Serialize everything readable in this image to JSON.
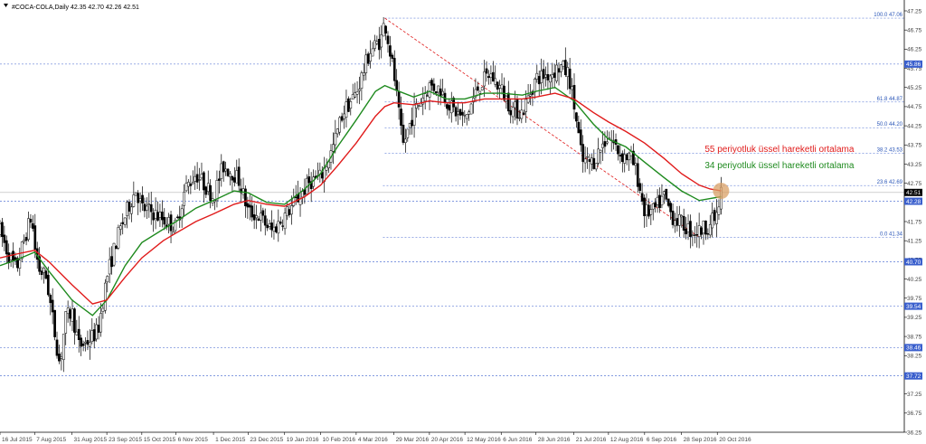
{
  "chart_data": {
    "type": "line",
    "title": "#COCA-COLA,Daily  42.35 42.70 42.26 42.51",
    "current_price": 42.51,
    "ylim": [
      36.25,
      47.25
    ],
    "y_ticks": [
      36.25,
      36.75,
      37.25,
      37.75,
      38.25,
      38.75,
      39.25,
      39.75,
      40.25,
      40.75,
      41.25,
      41.75,
      42.25,
      42.75,
      43.25,
      43.75,
      44.25,
      44.75,
      45.25,
      45.75,
      46.25,
      46.75,
      47.25
    ],
    "y_tick_labels": [
      "36.25",
      "36.75",
      "37.25",
      "37.75",
      "38.25",
      "38.75",
      "39.25",
      "39.75",
      "40.25",
      "40.75",
      "41.25",
      "41.75",
      "42.25",
      "42.75",
      "43.25",
      "43.75",
      "44.25",
      "44.75",
      "45.25",
      "45.75",
      "46.25",
      "46.75",
      "47.25"
    ],
    "x_tick_labels": [
      "16 Jul 2015",
      "7 Aug 2015",
      "31 Aug 2015",
      "23 Sep 2015",
      "15 Oct 2015",
      "6 Nov 2015",
      "1 Dec 2015",
      "23 Dec 2015",
      "19 Jan 2016",
      "10 Feb 2016",
      "4 Mar 2016",
      "29 Mar 2016",
      "20 Apr 2016",
      "12 May 2016",
      "6 Jun 2016",
      "28 Jun 2016",
      "21 Jul 2016",
      "12 Aug 2016",
      "6 Sep 2016",
      "28 Sep 2016",
      "20 Oct 2016"
    ],
    "x_tick_pos": [
      0.0,
      0.0636,
      0.1322,
      0.1963,
      0.2606,
      0.3235,
      0.3923,
      0.456,
      0.523,
      0.5891,
      0.6545,
      0.7238,
      0.7891,
      0.8543,
      0.921,
      0.9849,
      1.0547,
      1.1181,
      1.1845,
      1.2523,
      1.3181
    ],
    "price_levels": [
      45.86,
      42.28,
      40.7,
      39.54,
      38.46,
      37.72
    ],
    "price_level_labels": [
      "45.86",
      "42.28",
      "40.70",
      "39.54",
      "38.46",
      "37.72"
    ],
    "fibonacci": {
      "levels": [
        {
          "label": "100.0 47.06",
          "value": 47.06
        },
        {
          "label": "61.8 44.87",
          "value": 44.87
        },
        {
          "label": "50.0 44.20",
          "value": 44.2
        },
        {
          "label": "38.2 43.53",
          "value": 43.53
        },
        {
          "label": "23.6 42.69",
          "value": 42.69
        },
        {
          "label": "0.0 41.34",
          "value": 41.34
        }
      ],
      "trend_from": {
        "x": 0.707,
        "y": 47.06
      },
      "trend_to": {
        "x": 1.285,
        "y": 41.34
      }
    },
    "ohlc_points": [
      [
        0.0,
        41.5
      ],
      [
        0.015,
        40.9
      ],
      [
        0.03,
        40.5
      ],
      [
        0.045,
        41.3
      ],
      [
        0.058,
        41.9
      ],
      [
        0.0636,
        41.1
      ],
      [
        0.072,
        40.5
      ],
      [
        0.085,
        40.3
      ],
      [
        0.1,
        38.9
      ],
      [
        0.11,
        38.0
      ],
      [
        0.12,
        39.2
      ],
      [
        0.1322,
        39.4
      ],
      [
        0.145,
        38.5
      ],
      [
        0.16,
        38.6
      ],
      [
        0.18,
        38.9
      ],
      [
        0.1963,
        40.3
      ],
      [
        0.215,
        41.3
      ],
      [
        0.235,
        42.1
      ],
      [
        0.25,
        42.6
      ],
      [
        0.2606,
        42.1
      ],
      [
        0.28,
        42.0
      ],
      [
        0.3,
        41.8
      ],
      [
        0.3235,
        41.6
      ],
      [
        0.34,
        42.6
      ],
      [
        0.36,
        43.0
      ],
      [
        0.3923,
        42.4
      ],
      [
        0.41,
        43.2
      ],
      [
        0.43,
        43.0
      ],
      [
        0.44,
        42.8
      ],
      [
        0.456,
        42.0
      ],
      [
        0.475,
        41.9
      ],
      [
        0.5,
        41.5
      ],
      [
        0.523,
        41.9
      ],
      [
        0.545,
        42.3
      ],
      [
        0.57,
        42.8
      ],
      [
        0.5891,
        42.9
      ],
      [
        0.61,
        43.6
      ],
      [
        0.63,
        44.6
      ],
      [
        0.6545,
        45.1
      ],
      [
        0.68,
        46.2
      ],
      [
        0.7,
        46.5
      ],
      [
        0.707,
        47.0
      ],
      [
        0.7238,
        45.6
      ],
      [
        0.74,
        43.7
      ],
      [
        0.76,
        44.6
      ],
      [
        0.7891,
        45.3
      ],
      [
        0.81,
        45.2
      ],
      [
        0.83,
        44.7
      ],
      [
        0.8543,
        44.4
      ],
      [
        0.88,
        45.3
      ],
      [
        0.9,
        45.6
      ],
      [
        0.921,
        45.2
      ],
      [
        0.94,
        44.7
      ],
      [
        0.96,
        44.6
      ],
      [
        0.9849,
        45.5
      ],
      [
        1.01,
        45.6
      ],
      [
        1.03,
        45.8
      ],
      [
        1.045,
        45.6
      ],
      [
        1.0547,
        44.8
      ],
      [
        1.07,
        43.3
      ],
      [
        1.09,
        43.3
      ],
      [
        1.105,
        43.7
      ],
      [
        1.1181,
        44.0
      ],
      [
        1.14,
        43.5
      ],
      [
        1.16,
        43.4
      ],
      [
        1.17,
        43.0
      ],
      [
        1.1845,
        42.0
      ],
      [
        1.2,
        42.0
      ],
      [
        1.22,
        42.4
      ],
      [
        1.235,
        41.9
      ],
      [
        1.2523,
        41.7
      ],
      [
        1.27,
        41.5
      ],
      [
        1.285,
        41.5
      ],
      [
        1.305,
        41.7
      ],
      [
        1.3181,
        41.9
      ],
      [
        1.325,
        42.51
      ]
    ],
    "series": [
      {
        "name": "34 periyotluk üssel hareketli ortalama",
        "color": "#1e8a1e",
        "values": [
          [
            0.0,
            40.6
          ],
          [
            0.03,
            40.75
          ],
          [
            0.0636,
            40.95
          ],
          [
            0.09,
            40.45
          ],
          [
            0.1322,
            39.7
          ],
          [
            0.17,
            39.3
          ],
          [
            0.1963,
            39.7
          ],
          [
            0.23,
            40.6
          ],
          [
            0.2606,
            41.2
          ],
          [
            0.3,
            41.55
          ],
          [
            0.3235,
            41.75
          ],
          [
            0.36,
            42.1
          ],
          [
            0.3923,
            42.3
          ],
          [
            0.43,
            42.55
          ],
          [
            0.456,
            42.5
          ],
          [
            0.49,
            42.25
          ],
          [
            0.523,
            42.2
          ],
          [
            0.56,
            42.6
          ],
          [
            0.5891,
            43.0
          ],
          [
            0.62,
            43.7
          ],
          [
            0.6545,
            44.4
          ],
          [
            0.69,
            45.15
          ],
          [
            0.707,
            45.3
          ],
          [
            0.7238,
            45.2
          ],
          [
            0.76,
            45.0
          ],
          [
            0.7891,
            45.15
          ],
          [
            0.82,
            44.95
          ],
          [
            0.8543,
            44.95
          ],
          [
            0.89,
            45.1
          ],
          [
            0.921,
            45.1
          ],
          [
            0.96,
            45.05
          ],
          [
            0.9849,
            45.15
          ],
          [
            1.02,
            45.25
          ],
          [
            1.0547,
            44.9
          ],
          [
            1.09,
            44.3
          ],
          [
            1.1181,
            43.9
          ],
          [
            1.15,
            43.7
          ],
          [
            1.1845,
            43.3
          ],
          [
            1.22,
            42.9
          ],
          [
            1.2523,
            42.55
          ],
          [
            1.285,
            42.3
          ],
          [
            1.305,
            42.35
          ],
          [
            1.325,
            42.4
          ]
        ]
      },
      {
        "name": "55 periyotluk üssel hareketli ortalama",
        "color": "#e01b1b",
        "values": [
          [
            0.0,
            40.8
          ],
          [
            0.03,
            40.9
          ],
          [
            0.0636,
            41.0
          ],
          [
            0.09,
            40.7
          ],
          [
            0.1322,
            40.1
          ],
          [
            0.17,
            39.6
          ],
          [
            0.1963,
            39.7
          ],
          [
            0.23,
            40.3
          ],
          [
            0.2606,
            40.8
          ],
          [
            0.3,
            41.25
          ],
          [
            0.3235,
            41.45
          ],
          [
            0.36,
            41.75
          ],
          [
            0.3923,
            41.95
          ],
          [
            0.43,
            42.2
          ],
          [
            0.456,
            42.3
          ],
          [
            0.49,
            42.2
          ],
          [
            0.523,
            42.15
          ],
          [
            0.56,
            42.4
          ],
          [
            0.5891,
            42.7
          ],
          [
            0.62,
            43.2
          ],
          [
            0.6545,
            43.8
          ],
          [
            0.69,
            44.5
          ],
          [
            0.707,
            44.75
          ],
          [
            0.7238,
            44.85
          ],
          [
            0.76,
            44.8
          ],
          [
            0.7891,
            44.9
          ],
          [
            0.82,
            44.85
          ],
          [
            0.8543,
            44.85
          ],
          [
            0.89,
            44.95
          ],
          [
            0.921,
            44.95
          ],
          [
            0.96,
            44.95
          ],
          [
            0.9849,
            45.0
          ],
          [
            1.02,
            45.1
          ],
          [
            1.0547,
            44.95
          ],
          [
            1.09,
            44.6
          ],
          [
            1.1181,
            44.35
          ],
          [
            1.15,
            44.1
          ],
          [
            1.1845,
            43.8
          ],
          [
            1.22,
            43.4
          ],
          [
            1.2523,
            43.0
          ],
          [
            1.285,
            42.7
          ],
          [
            1.305,
            42.6
          ],
          [
            1.325,
            42.55
          ]
        ]
      }
    ],
    "marker": {
      "x": 1.325,
      "y": 42.55,
      "color": "#d9a066"
    },
    "annotations": [
      {
        "text": "55 periyotluk üssel hareketli ortalama",
        "color": "#e01b1b",
        "x": 1.295,
        "y": 43.57
      },
      {
        "text": "34 periyotluk üssel hareketli ortalama",
        "color": "#1e8a1e",
        "x": 1.295,
        "y": 43.14
      }
    ],
    "grid": false,
    "legend": "none",
    "xlim": [
      0.0,
      1.6617
    ]
  }
}
